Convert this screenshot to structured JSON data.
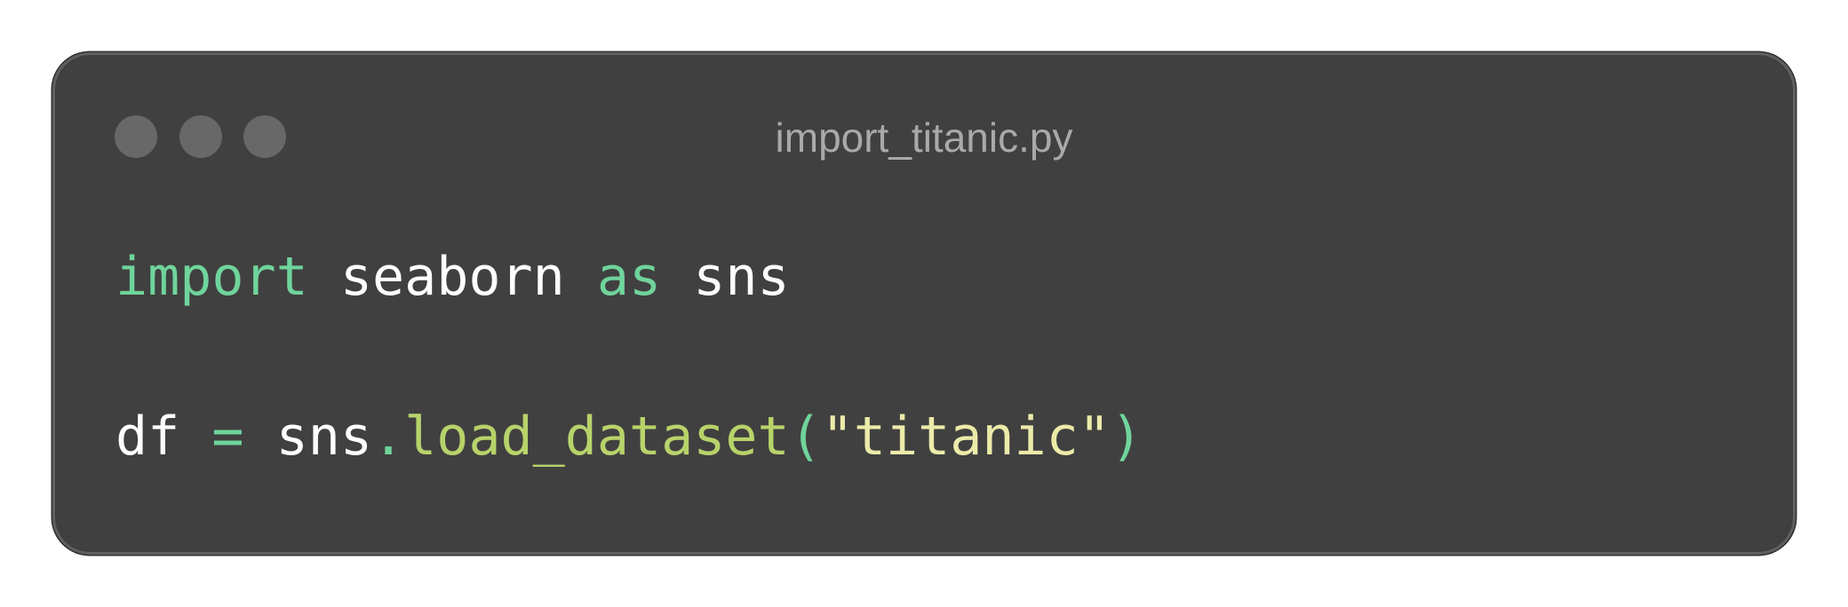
{
  "window": {
    "title": "import_titanic.py",
    "controls": [
      "close",
      "minimize",
      "maximize"
    ]
  },
  "code": {
    "line1": {
      "kw_import": "import",
      "mod": " seaborn ",
      "kw_as": "as",
      "alias": " sns"
    },
    "line2": {
      "var": "df ",
      "eq": "=",
      "obj": " sns",
      "dot": ".",
      "func": "load_dataset",
      "lparen": "(",
      "arg": "\"titanic\"",
      "rparen": ")"
    }
  },
  "colors": {
    "background": "#404040",
    "keyword": "#6fd49b",
    "function": "#b8d36a",
    "string": "#ecebaa",
    "text": "#ffffff",
    "title": "#a9a9a9",
    "window_dot": "#686868"
  }
}
